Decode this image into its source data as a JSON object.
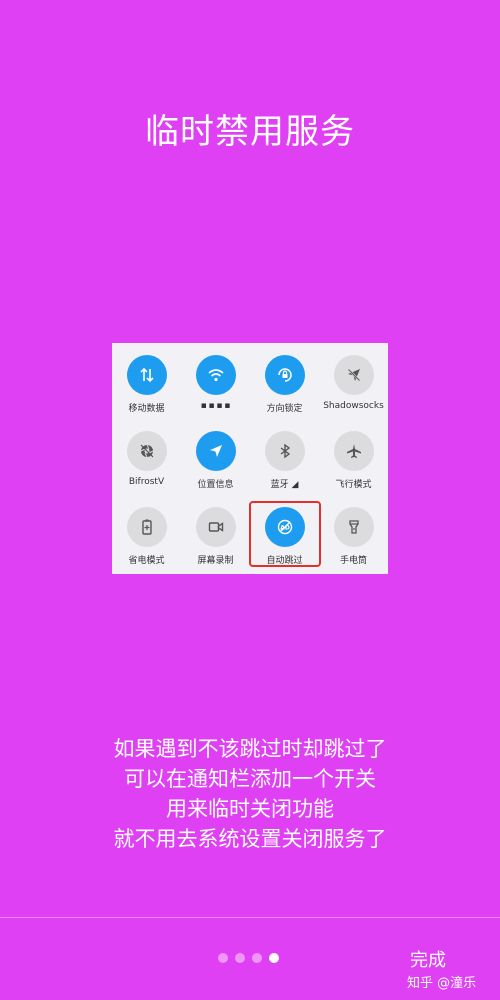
{
  "page": {
    "title": "临时禁用服务",
    "description": [
      "如果遇到不该跳过时却跳过了",
      "可以在通知栏添加一个开关",
      "用来临时关闭功能",
      "就不用去系统设置关闭服务了"
    ],
    "done_label": "完成",
    "watermark": "知乎 @潼乐",
    "pager": {
      "total": 4,
      "current": 4
    }
  },
  "quick_settings": {
    "rows": [
      [
        {
          "label": "移动数据",
          "icon": "mobile-data-icon",
          "active": true
        },
        {
          "label": "▪ ▪ ▪ ▪",
          "icon": "wifi-icon",
          "active": true
        },
        {
          "label": "方向锁定",
          "icon": "rotation-lock-icon",
          "active": true
        },
        {
          "label": "Shadowsocks",
          "icon": "shadowsocks-icon",
          "active": false
        }
      ],
      [
        {
          "label": "BifrostV",
          "icon": "bifrost-icon",
          "active": false
        },
        {
          "label": "位置信息",
          "icon": "location-icon",
          "active": true
        },
        {
          "label": "蓝牙 ◢",
          "icon": "bluetooth-icon",
          "active": false
        },
        {
          "label": "飞行模式",
          "icon": "airplane-icon",
          "active": false
        }
      ],
      [
        {
          "label": "省电模式",
          "icon": "battery-saver-icon",
          "active": false
        },
        {
          "label": "屏幕录制",
          "icon": "screen-record-icon",
          "active": false
        },
        {
          "label": "自动跳过",
          "icon": "auto-skip-icon",
          "active": true
        },
        {
          "label": "手电筒",
          "icon": "flashlight-icon",
          "active": false
        }
      ]
    ]
  },
  "colors": {
    "background": "#e040f4",
    "active_tile": "#1e9cf0",
    "inactive_tile": "#dcdcdf",
    "highlight_border": "#e0312d"
  }
}
